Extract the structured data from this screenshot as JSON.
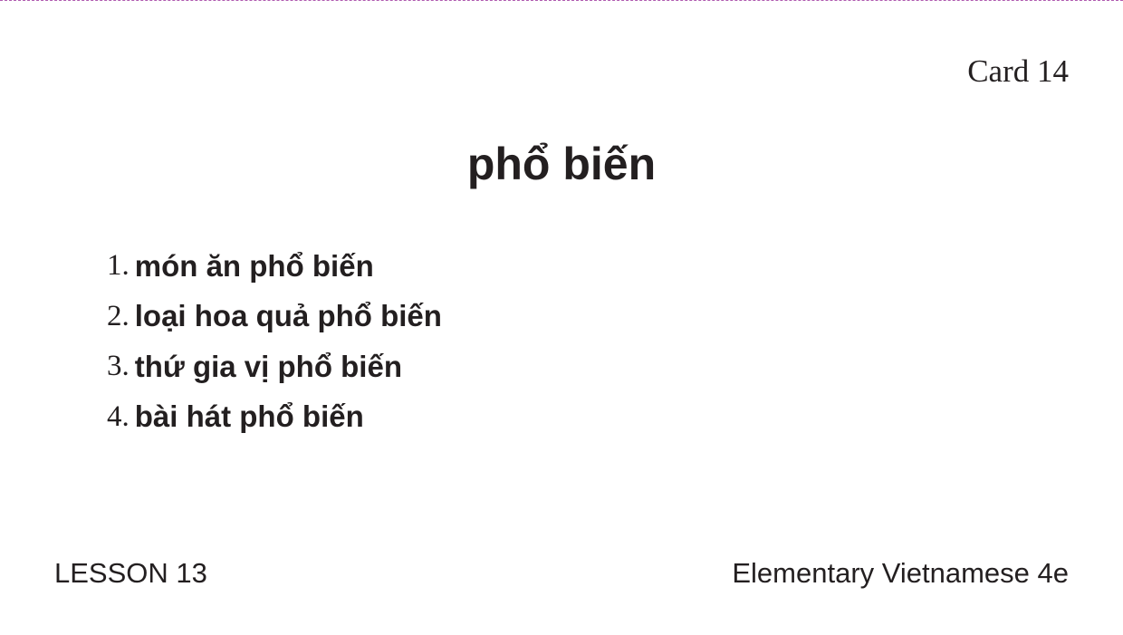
{
  "card": {
    "number_label": "Card 14",
    "headword": "phổ biến",
    "examples": [
      {
        "number": "1.",
        "text": "món ăn phổ biến"
      },
      {
        "number": "2.",
        "text": "loại hoa quả phổ biến"
      },
      {
        "number": "3.",
        "text": "thứ gia vị phổ biến"
      },
      {
        "number": "4.",
        "text": "bài hát phổ biến"
      }
    ]
  },
  "footer": {
    "lesson": "LESSON 13",
    "book_title": "Elementary Vietnamese 4e"
  },
  "colors": {
    "text": "#231f20",
    "cut_line": "#b05bb0",
    "background": "#ffffff"
  }
}
